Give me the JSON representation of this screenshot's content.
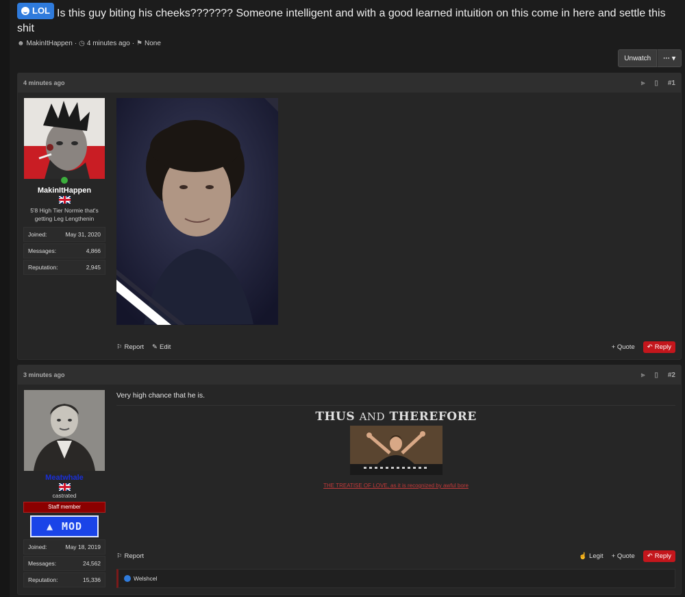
{
  "thread": {
    "prefix": "LOL",
    "title": "Is this guy biting his cheeks??????? Someone intelligent and with a good learned intuition on this come in here and settle this shit",
    "author": "MakinItHappen",
    "age": "4 minutes ago",
    "tags": "None"
  },
  "toolbar": {
    "unwatch": "Unwatch",
    "more": "··· ▾"
  },
  "posts": [
    {
      "time": "4 minutes ago",
      "number": "#1",
      "user": {
        "name": "MakinItHappen",
        "title": "5'8 High Tier Normie that's getting Leg Lengthenin",
        "stats": [
          {
            "label": "Joined:",
            "value": "May 31, 2020"
          },
          {
            "label": "Messages:",
            "value": "4,866"
          },
          {
            "label": "Reputation:",
            "value": "2,945"
          }
        ]
      },
      "actions": {
        "report": "Report",
        "edit": "Edit",
        "quote": "+ Quote",
        "reply": "Reply"
      }
    },
    {
      "time": "3 minutes ago",
      "number": "#2",
      "body": "Very high chance that he is.",
      "sig": {
        "heading1": "THUS",
        "heading2": "AND",
        "heading3": "THEREFORE",
        "link": "THE TREATISE OF LOVE, as it is recognized by awful bore"
      },
      "user": {
        "name": "Meatwhale",
        "title": "castrated",
        "staff": "Staff member",
        "banner": "MOD",
        "stats": [
          {
            "label": "Joined:",
            "value": "May 18, 2019"
          },
          {
            "label": "Messages:",
            "value": "24,562"
          },
          {
            "label": "Reputation:",
            "value": "15,336"
          }
        ]
      },
      "actions": {
        "report": "Report",
        "legit": "Legit",
        "quote": "+ Quote",
        "reply": "Reply"
      },
      "reaction_user": "Welshcel"
    }
  ],
  "colors": {
    "accent": "#2f7bdc",
    "reply": "#c4161c",
    "staff": "#8b0000",
    "mod": "#1a44e8"
  }
}
